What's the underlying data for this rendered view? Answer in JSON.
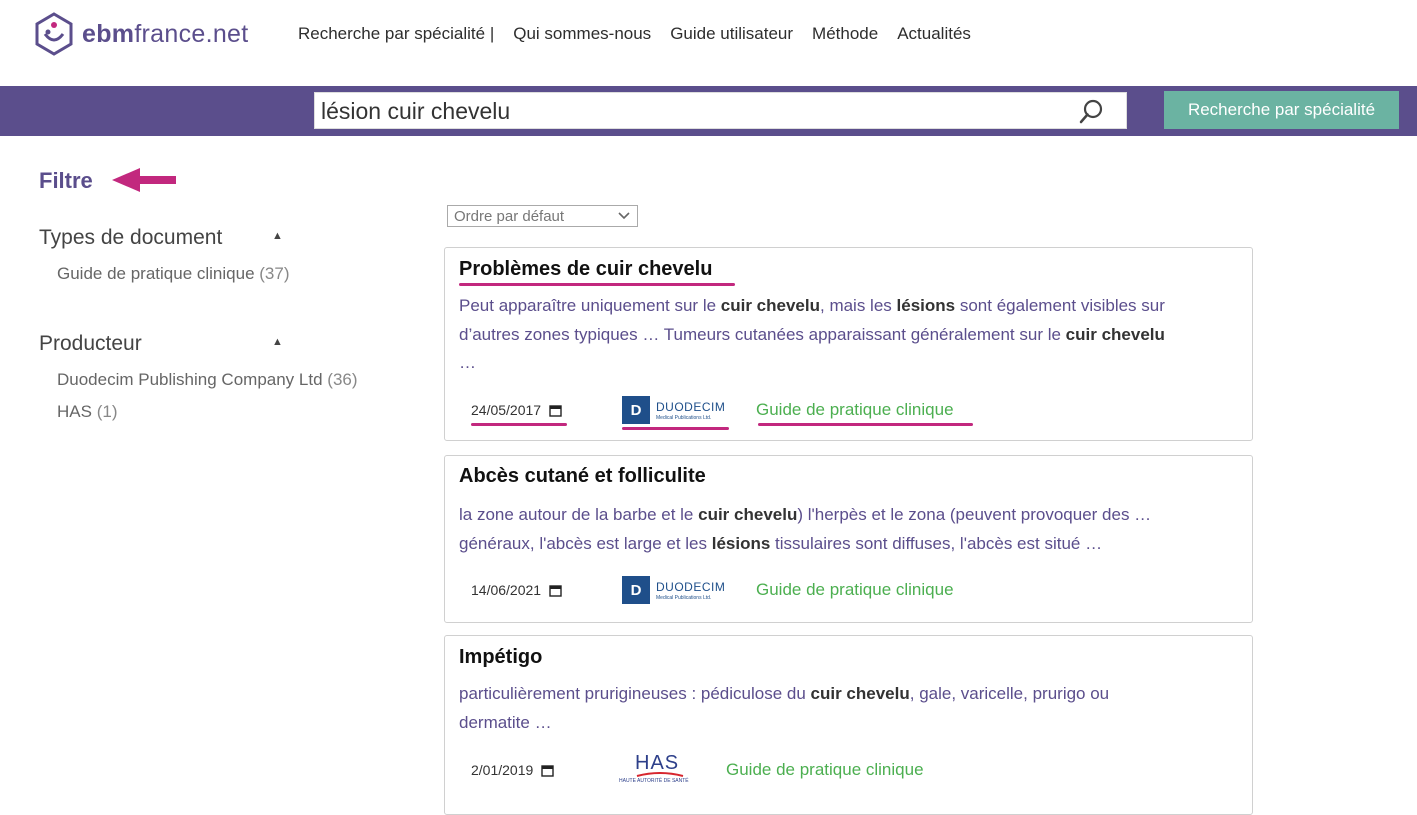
{
  "header": {
    "logo_text_bold": "ebm",
    "logo_text_rest": "france.net",
    "nav": [
      "Recherche par spécialité |",
      "Qui sommes-nous",
      "Guide utilisateur",
      "Méthode",
      "Actualités"
    ]
  },
  "search": {
    "value": "lésion cuir chevelu",
    "button_label": "Recherche par spécialité"
  },
  "sidebar": {
    "title": "Filtre",
    "facets": [
      {
        "title": "Types de document",
        "items": [
          {
            "label": "Guide de pratique clinique",
            "count": "(37)"
          }
        ]
      },
      {
        "title": "Producteur",
        "items": [
          {
            "label": "Duodecim Publishing Company Ltd",
            "count": "(36)"
          },
          {
            "label": "HAS",
            "count": "(1)"
          }
        ]
      }
    ]
  },
  "sort": {
    "selected": "Ordre par défaut"
  },
  "results": [
    {
      "title": "Problèmes de cuir chevelu",
      "snippet_lines": [
        [
          "Peut apparaître uniquement sur le ",
          "<b>cuir chevelu</b>",
          ", mais les ",
          "<b>lésions</b>",
          " sont également visibles sur"
        ],
        [
          "d’autres zones typiques … Tumeurs cutanées apparaissant généralement sur le ",
          "<b>cuir chevelu</b>"
        ],
        [
          "…"
        ]
      ],
      "date": "24/05/2017",
      "publisher": "DUODECIM",
      "publisher_sub": "Medical Publications Ltd.",
      "type": "Guide de pratique clinique"
    },
    {
      "title": "Abcès cutané et folliculite",
      "snippet_lines": [
        [
          "la zone autour de la barbe et le ",
          "<b>cuir chevelu</b>",
          ") l'herpès et le zona (peuvent provoquer des …"
        ],
        [
          "généraux, l'abcès est large et les ",
          "<b>lésions</b>",
          " tissulaires sont diffuses, l'abcès est situé …"
        ]
      ],
      "date": "14/06/2021",
      "publisher": "DUODECIM",
      "publisher_sub": "Medical Publications Ltd.",
      "type": "Guide de pratique clinique"
    },
    {
      "title": "Impétigo",
      "snippet_lines": [
        [
          "particulièrement prurigineuses : pédiculose du ",
          "<b>cuir chevelu</b>",
          ", gale, varicelle, prurigo ou"
        ],
        [
          "dermatite …"
        ]
      ],
      "date": "2/01/2019",
      "publisher": "HAS",
      "publisher_sub": "HAUTE AUTORITÉ DE SANTÉ",
      "type": "Guide de pratique clinique"
    }
  ],
  "colors": {
    "brand": "#5b4e8c",
    "accent_button": "#6bb3a2",
    "annotation": "#c2287e",
    "doc_type": "#4caf50"
  }
}
